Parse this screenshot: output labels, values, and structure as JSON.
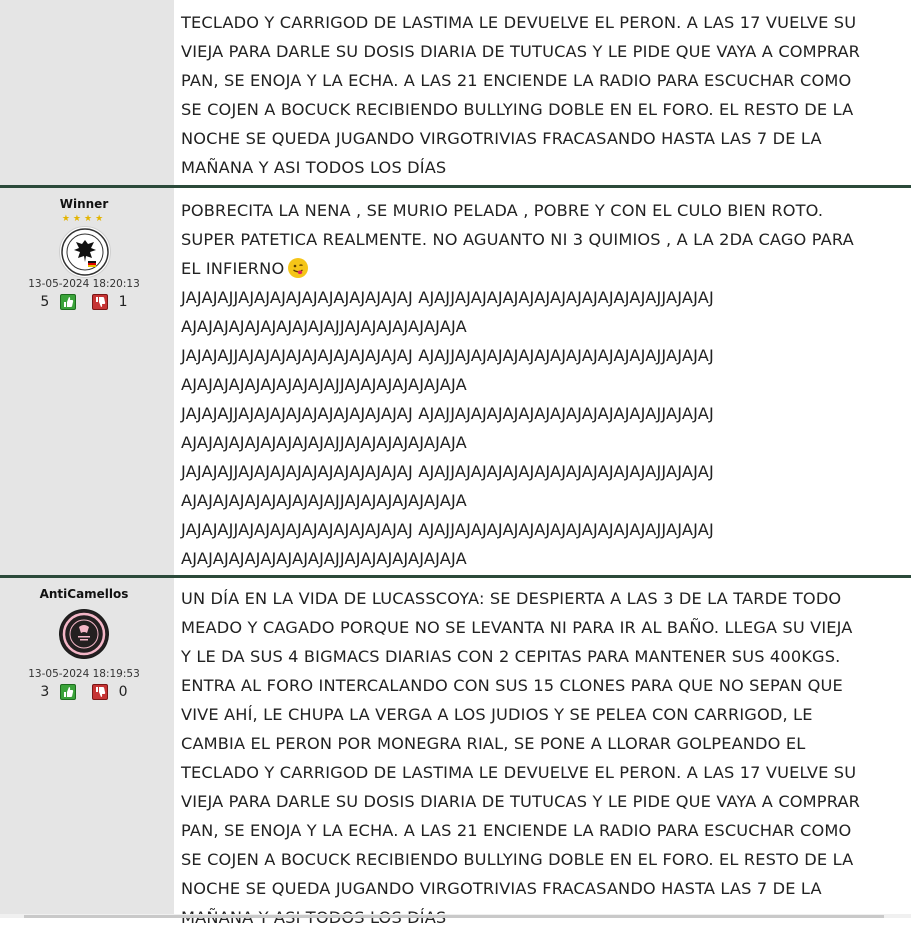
{
  "posts": [
    {
      "lines": [
        "TECLADO Y CARRIGOD DE LASTIMA LE DEVUELVE EL PERON. A LAS 17 VUELVE SU",
        "VIEJA PARA DARLE SU DOSIS DIARIA DE TUTUCAS Y LE PIDE QUE VAYA A COMPRAR",
        "PAN, SE ENOJA Y LA ECHA. A LAS 21 ENCIENDE LA RADIO PARA ESCUCHAR COMO",
        "SE COJEN A BOCUCK RECIBIENDO BULLYING DOBLE EN EL FORO. EL RESTO DE LA",
        "NOCHE SE QUEDA JUGANDO VIRGOTRIVIAS FRACASANDO HASTA LAS 7 DE LA",
        "MAÑANA Y ASI TODOS LOS DÍAS"
      ]
    },
    {
      "username": "Winner",
      "stars": "★★★★",
      "avatar_icon": "germany-crest-icon",
      "date": "13-05-2024 18:20:13",
      "likes": "5",
      "dislikes": "1",
      "lines": [
        "POBRECITA LA NENA , SE MURIO PELADA , POBRE Y CON EL CULO BIEN ROTO.",
        "SUPER PATETICA REALMENTE. NO AGUANTO NI 3 QUIMIOS , A LA 2DA CAGO PARA",
        "EL INFIERNO",
        "JAJAJAJJAJAJAJAJAJAJAJAJAJAJAJ AJAJJAJAJAJAJAJAJAJAJAJAJAJAJAJJAJAJAJ",
        "AJAJAJAJAJAJAJAJAJAJJAJAJAJAJAJAJAJA",
        "JAJAJAJJAJAJAJAJAJAJAJAJAJAJAJ AJAJJAJAJAJAJAJAJAJAJAJAJAJAJAJJAJAJAJ",
        "AJAJAJAJAJAJAJAJAJAJJAJAJAJAJAJAJAJA",
        "JAJAJAJJAJAJAJAJAJAJAJAJAJAJAJ AJAJJAJAJAJAJAJAJAJAJAJAJAJAJAJJAJAJAJ",
        "AJAJAJAJAJAJAJAJAJAJJAJAJAJAJAJAJAJA",
        "JAJAJAJJAJAJAJAJAJAJAJAJAJAJAJ AJAJJAJAJAJAJAJAJAJAJAJAJAJAJAJJAJAJAJ",
        "AJAJAJAJAJAJAJAJAJAJJAJAJAJAJAJAJAJA",
        "JAJAJAJJAJAJAJAJAJAJAJAJAJAJAJ AJAJJAJAJAJAJAJAJAJAJAJAJAJAJAJJAJAJAJ",
        "AJAJAJAJAJAJAJAJAJAJJAJAJAJAJAJAJAJA"
      ],
      "emoji_icon": "smiling-face-tongue-icon"
    },
    {
      "username": "AntiCamellos",
      "avatar_icon": "inter-miami-crest-icon",
      "date": "13-05-2024 18:19:53",
      "likes": "3",
      "dislikes": "0",
      "lines": [
        "UN DÍA EN LA VIDA DE LUCASSCOYA: SE DESPIERTA A LAS 3 DE LA TARDE TODO",
        "MEADO Y CAGADO PORQUE NO SE LEVANTA NI PARA IR AL BAÑO. LLEGA SU VIEJA",
        "Y LE DA SUS 4 BIGMACS DIARIAS CON 2 CEPITAS PARA MANTENER SUS 400KGS.",
        "ENTRA AL FORO INTERCALANDO CON SUS 15 CLONES PARA QUE NO SEPAN QUE",
        "VIVE AHÍ, LE CHUPA LA VERGA A LOS JUDIOS Y SE PELEA CON CARRIGOD, LE",
        "CAMBIA EL PERON POR MONEGRA RIAL, SE PONE A LLORAR GOLPEANDO EL",
        "TECLADO Y CARRIGOD DE LASTIMA LE DEVUELVE EL PERON. A LAS 17 VUELVE SU",
        "VIEJA PARA DARLE SU DOSIS DIARIA DE TUTUCAS Y LE PIDE QUE VAYA A COMPRAR",
        "PAN, SE ENOJA Y LA ECHA. A LAS 21 ENCIENDE LA RADIO PARA ESCUCHAR COMO",
        "SE COJEN A BOCUCK RECIBIENDO BULLYING DOBLE EN EL FORO. EL RESTO DE LA",
        "NOCHE SE QUEDA JUGANDO VIRGOTRIVIAS FRACASANDO HASTA LAS 7 DE LA",
        "MAÑANA Y ASI TODOS LOS DÍAS"
      ]
    }
  ],
  "colors": {
    "sidebar_bg": "#e5e5e5",
    "divider": "#2b4a3a",
    "like": "#3aa33a",
    "dislike": "#c63333",
    "star": "#e3b400"
  }
}
